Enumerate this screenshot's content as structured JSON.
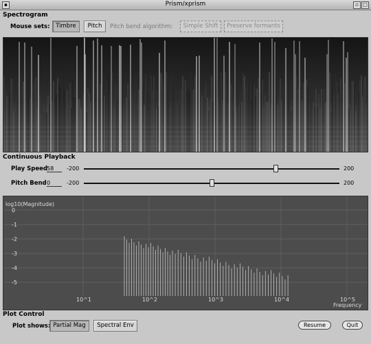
{
  "window": {
    "title": "Prism/xprism"
  },
  "spectrogram": {
    "section_title": "Spectrogram",
    "mouse_sets_label": "Mouse sets:",
    "timbre_button": "Timbre",
    "pitch_button": "Pitch",
    "pitch_bend_algorithm_label": "Pitch bend algorithm:",
    "algo_simple_button": "Simple Shift",
    "algo_preserve_button": "Preserve formants"
  },
  "playback": {
    "section_title": "Continuous Playback",
    "play_speed_label": "Play Speed",
    "play_speed_value": "58",
    "play_speed_min": "-200",
    "play_speed_max": "200",
    "play_speed_position": 0.75,
    "pitch_bend_label": "Pitch Bend",
    "pitch_bend_value": "0",
    "pitch_bend_min": "-200",
    "pitch_bend_max": "200",
    "pitch_bend_position": 0.5
  },
  "plot": {
    "ylabel": "log10(Magnitude)",
    "y_ticks": [
      "0",
      "-1",
      "-2",
      "-3",
      "-4",
      "-5"
    ],
    "x_ticks": [
      "10^1",
      "10^2",
      "10^3",
      "10^4",
      "10^5"
    ],
    "xlabel": "Frequency"
  },
  "plot_control": {
    "section_title": "Plot Control",
    "plot_shows_label": "Plot shows:",
    "partial_mag_button": "Partial Mag",
    "spectral_env_button": "Spectral Env",
    "resume_button": "Resume",
    "quit_button": "Quit"
  }
}
